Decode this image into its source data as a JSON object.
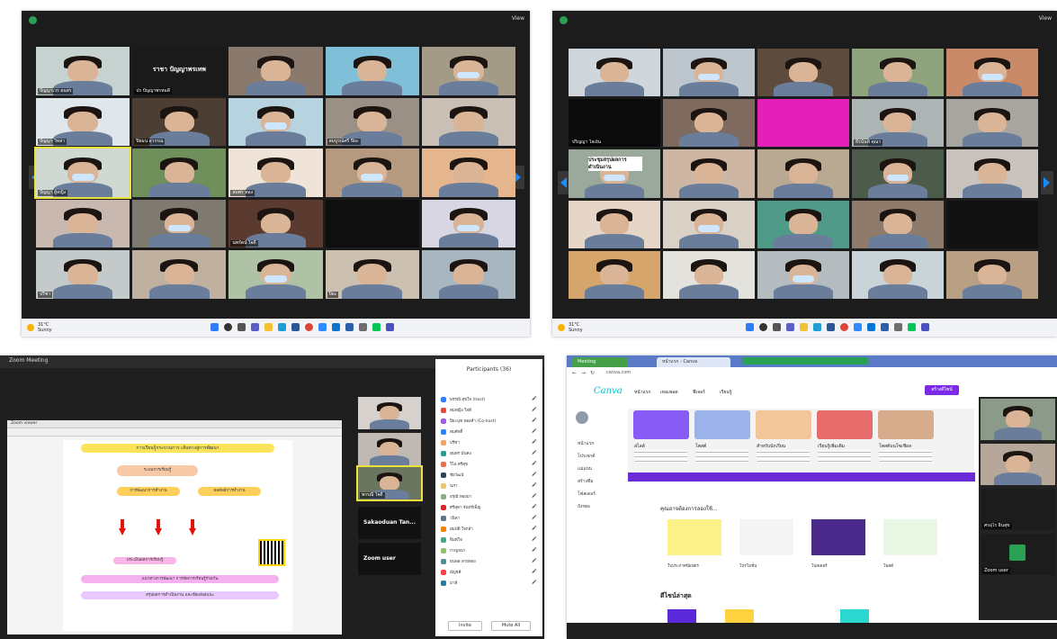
{
  "colors": {
    "zoom_bg": "#1c1c1c",
    "taskbar_bg": "#f1f3f6",
    "canva_purple": "#7d2ae8",
    "zoom_green": "#2aa052",
    "arrow_blue": "#1a8cff"
  },
  "screen1": {
    "view_label": "View",
    "weather": {
      "temp": "31°C",
      "cond": "Sunny"
    },
    "tiles": [
      {
        "name": "ปัญญาเวร อนสร",
        "bg": "#c7d3d0"
      },
      {
        "name": "ปร ปัญญาพรหมดี",
        "bg": "#1a1a1a"
      },
      {
        "name": "",
        "bg": "#8a7a6e"
      },
      {
        "name": "",
        "bg": "#7fbfd8"
      },
      {
        "name": "",
        "bg": "#a39a88"
      },
      {
        "name": "ปัญญา วิทยา",
        "bg": "#dfe7ec"
      },
      {
        "name": "ปิยมน สุวรรณ",
        "bg": "#4d3e33"
      },
      {
        "name": "",
        "bg": "#b7d3df"
      },
      {
        "name": "สมบูรณ์ศรี ปิยะ",
        "bg": "#9a9085"
      },
      {
        "name": "",
        "bg": "#c9bfb4"
      },
      {
        "name": "ปัญญา ผู้หญิง",
        "bg": "#cfd8d3"
      },
      {
        "name": "",
        "bg": "#6f8f5b"
      },
      {
        "name": "สมพร ทอง",
        "bg": "#f0e4d8"
      },
      {
        "name": "",
        "bg": "#b59a80"
      },
      {
        "name": "",
        "bg": "#e5b68e"
      },
      {
        "name": "",
        "bg": "#c9b8b0"
      },
      {
        "name": "",
        "bg": "#7e7a70"
      },
      {
        "name": "นพรัตน์ ใจดี",
        "bg": "#5b3a30"
      },
      {
        "name": "",
        "bg": "#0f0f0f"
      },
      {
        "name": "",
        "bg": "#d7d6e2"
      },
      {
        "name": "ปรีชา",
        "bg": "#c4c9c9"
      },
      {
        "name": "",
        "bg": "#bfb0a0"
      },
      {
        "name": "",
        "bg": "#b0c2a5"
      },
      {
        "name": "ปิยะ",
        "bg": "#ccc0b1"
      },
      {
        "name": "",
        "bg": "#a8b6bf"
      }
    ],
    "name_tile_text": "ราชา ปัญญาพรเทพ"
  },
  "screen2": {
    "view_label": "View",
    "weather": {
      "temp": "31°C",
      "cond": "Sunny"
    },
    "tiles": [
      {
        "name": "",
        "bg": "#cfd7dc"
      },
      {
        "name": "",
        "bg": "#bcc6cc"
      },
      {
        "name": "",
        "bg": "#5d4b3d"
      },
      {
        "name": "",
        "bg": "#8fa47d"
      },
      {
        "name": "",
        "bg": "#c98a6a"
      },
      {
        "name": "ปริญญา ใจเย็น",
        "bg": "#0b0b0b"
      },
      {
        "name": "",
        "bg": "#7e6a5e"
      },
      {
        "name": "",
        "bg": "#e321b8"
      },
      {
        "name": "ธีรนันท์ คุณา",
        "bg": "#adb4b4"
      },
      {
        "name": "",
        "bg": "#a7a5a0"
      },
      {
        "name": "",
        "bg": "#9aa99b"
      },
      {
        "name": "",
        "bg": "#cdb7a4"
      },
      {
        "name": "",
        "bg": "#b9a993"
      },
      {
        "name": "",
        "bg": "#4d5b4a"
      },
      {
        "name": "",
        "bg": "#c8c3bc"
      },
      {
        "name": "",
        "bg": "#e5d6c8"
      },
      {
        "name": "",
        "bg": "#d9d0c6"
      },
      {
        "name": "",
        "bg": "#4f9a88"
      },
      {
        "name": "",
        "bg": "#8e7b6c"
      },
      {
        "name": "",
        "bg": "#121212"
      },
      {
        "name": "",
        "bg": "#d6a56b"
      },
      {
        "name": "",
        "bg": "#e3e2dc"
      },
      {
        "name": "",
        "bg": "#b4bcc0"
      },
      {
        "name": "",
        "bg": "#c8d4d8"
      },
      {
        "name": "",
        "bg": "#b99f84"
      }
    ],
    "slide_tile_text": "ประชุมสรุปผลการ ดำเนินงาน"
  },
  "screen3": {
    "window_title": "Zoom Meeting",
    "viewer_title": "Zoom viewer",
    "slide_title": "การเรียนรู้กระบวนการ เส้นทางสู่การพัฒนา",
    "slide_blocks": [
      {
        "text": "ระบบการเรียนรู้",
        "bg": "#f7c9a7"
      },
      {
        "text": "การพัฒนาการทำงาน",
        "bg": "#ffcf5c"
      },
      {
        "text": "ผลลัพธ์การทำงาน",
        "bg": "#ffcf5c"
      },
      {
        "text": "ประเมินผลการเรียนรู้",
        "bg": "#f9b6e6"
      },
      {
        "text": "แนวทางการพัฒนา การจัดการเรียนรู้ร่วมกัน",
        "bg": "#f5b0ef"
      },
      {
        "text": "สรุปผลการดำเนินงาน และข้อเสนอแนะ",
        "bg": "#e8c8ff"
      }
    ],
    "speaker_tiles": [
      {
        "name": "",
        "bg": "#d7d1cd"
      },
      {
        "name": "",
        "bg": "#bfb8b3"
      },
      {
        "name": "พรรณี ใจดี",
        "bg": "#6a7660"
      },
      {
        "name": "Sakaoduan Tan...",
        "bg": "#111111"
      },
      {
        "name": "Zoom user",
        "bg": "#111111"
      }
    ],
    "participants_title": "Participants (36)",
    "participants": [
      {
        "name": "พรรณี สุขใจ (Host)",
        "color": "#2c83ff"
      },
      {
        "name": "สมหญิง ใจดี",
        "color": "#e34b4b"
      },
      {
        "name": "ปิยะนุช ทองคำ (Co-host)",
        "color": "#9b5de5"
      },
      {
        "name": "สมศักดิ์",
        "color": "#2c83ff"
      },
      {
        "name": "ปรีชา",
        "color": "#f4a261"
      },
      {
        "name": "สุนทร มั่นคง",
        "color": "#2a9d8f"
      },
      {
        "name": "วิไล ศรีสุข",
        "color": "#e76f51"
      },
      {
        "name": "ชัยวัฒน์",
        "color": "#264653"
      },
      {
        "name": "นภา",
        "color": "#e9c46a"
      },
      {
        "name": "อรุณี ทองมา",
        "color": "#8ab17d"
      },
      {
        "name": "ศรีสุดา จันทร์เพ็ญ",
        "color": "#d62828"
      },
      {
        "name": "วนิดา",
        "color": "#577590"
      },
      {
        "name": "สมบัติ ใจกล้า",
        "color": "#f77f00"
      },
      {
        "name": "พิมพ์ใจ",
        "color": "#43aa8b"
      },
      {
        "name": "กาญจนา",
        "color": "#90be6d"
      },
      {
        "name": "ธนพล สายทอง",
        "color": "#4d908e"
      },
      {
        "name": "อัญชลี",
        "color": "#f94144"
      },
      {
        "name": "มาลี",
        "color": "#277da1"
      }
    ],
    "invite_label": "Invite",
    "mute_all_label": "Mute All"
  },
  "screen4": {
    "tabs": [
      "Meeting",
      "หน้าแรก - Canva"
    ],
    "url": "canva.com",
    "logo": "Canva",
    "nav": [
      "หน้าแรก",
      "เทมเพลต",
      "ฟีเจอร์",
      "เรียนรู้"
    ],
    "create_btn": "สร้างดีไซน์",
    "sidebar": [
      "หน้าแรก",
      "โปรเจกต์",
      "แม่แบบ",
      "สร้างทีม",
      "โฟลเดอร์",
      "ถังขยะ"
    ],
    "banner_cards": [
      {
        "title": "สไลด์",
        "img": "#8a5cf6"
      },
      {
        "title": "โพสต์",
        "img": "#9bb3e8"
      },
      {
        "title": "สำหรับนักเรียน",
        "img": "#f3c69a"
      },
      {
        "title": "เรียนรู้เพิ่มเติม",
        "img": "#e86b6b"
      },
      {
        "title": "โพสต์บนโซเชียล",
        "img": "#d6ac8d"
      }
    ],
    "section_title": "คุณอาจต้องการลองใช้...",
    "design_cards": [
      {
        "label": "ใบประกาศนียบัตร",
        "bg": "#fdf28a"
      },
      {
        "label": "โปรโมชั่น",
        "bg": "#f4f4f4"
      },
      {
        "label": "โปสเตอร์",
        "bg": "#4a2a8a"
      },
      {
        "label": "โพสต์",
        "bg": "#e9f7e5"
      }
    ],
    "section2_title": "ดีไซน์ล่าสุด",
    "video_names": [
      "",
      "",
      "ศรอุไร อินสุข",
      "Zoom user"
    ]
  }
}
